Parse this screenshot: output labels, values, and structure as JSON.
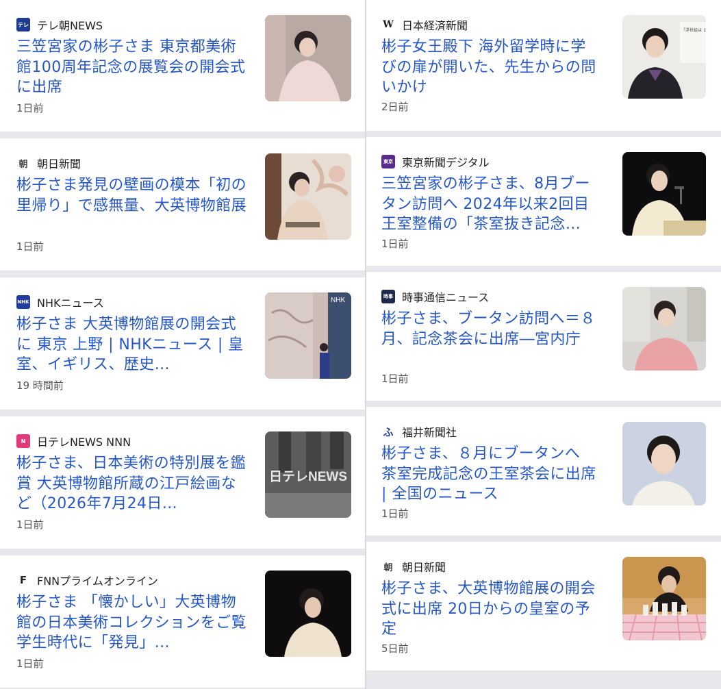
{
  "left_column": [
    {
      "source": "テレ朝NEWS",
      "logo": "テ",
      "logo_color": "#1c3d8f",
      "headline": "三笠宮家の彬子さま 東京都美術館100周年記念の展覧会の開会式に出席",
      "time": "1日前"
    },
    {
      "source": "朝日新聞",
      "logo": "朝",
      "logo_color": "#ffffff",
      "headline": "彬子さま発見の壁画の模本「初の里帰り」で感無量、大英博物館展",
      "time": "1日前"
    },
    {
      "source": "NHKニュース",
      "logo": "NHK",
      "logo_color": "#1f3ea0",
      "headline": "彬子さま 大英博物館展の開会式に 東京 上野 | NHKニュース | 皇室、イギリス、歴史…",
      "time": "19 時間前"
    },
    {
      "source": "日テレNEWS NNN",
      "logo": "N",
      "logo_color": "#e23a7a",
      "headline": "彬子さま、日本美術の特別展を鑑賞 大英博物館所蔵の江戸絵画など（2026年7月24日…",
      "time": "1日前"
    },
    {
      "source": "FNNプライムオンライン",
      "logo": "F",
      "logo_color": "#ffffff",
      "headline": "彬子さま 「懐かしい」大英博物館の日本美術コレクションをご覧 学生時代に「発見」…",
      "time": "1日前"
    }
  ],
  "right_column": [
    {
      "source": "日本経済新聞",
      "logo": "W",
      "logo_color": "#ffffff",
      "headline": "彬子女王殿下 海外留学時に学びの扉が開いた、先生からの問いかけ",
      "time": "2日前"
    },
    {
      "source": "東京新聞デジタル",
      "logo": "東京",
      "logo_color": "#5a2a8a",
      "headline": "三笠宮家の彬子さま、8月ブータン訪問へ 2024年以来2回目 王室整備の「茶室抜き記念…",
      "time": "1日前"
    },
    {
      "source": "時事通信ニュース",
      "logo": "時",
      "logo_color": "#1d2a4a",
      "headline": "彬子さま、ブータン訪問へ＝８月、記念茶会に出席―宮内庁",
      "time": "1日前"
    },
    {
      "source": "福井新聞社",
      "logo": "ふ",
      "logo_color": "#ffffff",
      "headline": "彬子さま、８月にブータンへ 茶室完成記念の王室茶会に出席 | 全国のニュース",
      "time": "1日前"
    },
    {
      "source": "朝日新聞",
      "logo": "朝",
      "logo_color": "#ffffff",
      "headline": "彬子さま、大英博物館展の開会式に出席 20日からの皇室の予定",
      "time": "5日前"
    }
  ],
  "thumb_texts": {
    "ntv_watermark": "日テレNEWS",
    "nhk_watermark": "NHK",
    "nikkei_sign": "「浮世絵は どのように 見るもので"
  }
}
